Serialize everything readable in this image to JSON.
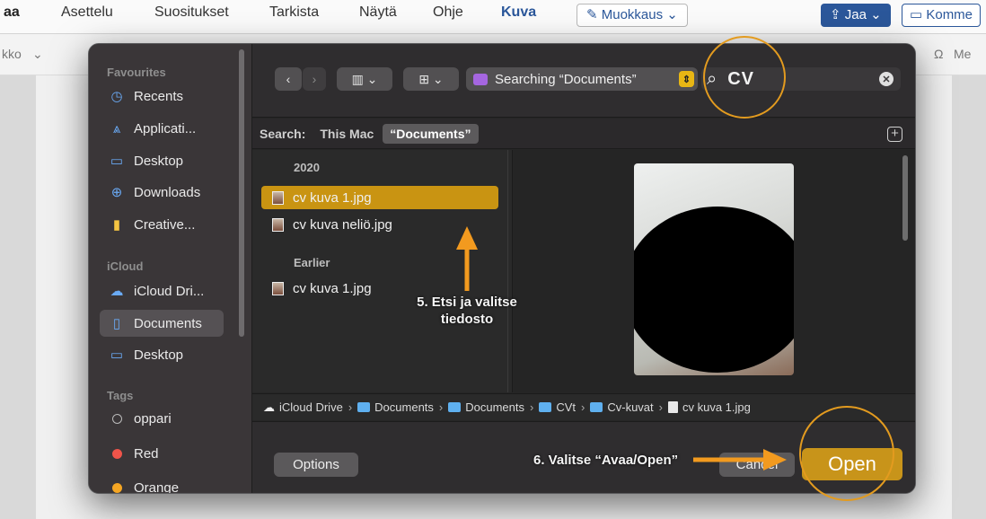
{
  "word": {
    "tabs": [
      "aa",
      "Asettelu",
      "Suositukset",
      "Tarkista",
      "Näytä",
      "Ohje",
      "Kuva"
    ],
    "edit_label": "Muokkaus",
    "share_label": "Jaa",
    "comment_label": "Komme",
    "toolbar_left": "kko",
    "toolbar_right": "Me"
  },
  "sidebar": {
    "favourites_title": "Favourites",
    "favourites": [
      {
        "label": "Recents",
        "icon": "clock-icon"
      },
      {
        "label": "Applicati...",
        "icon": "applications-icon"
      },
      {
        "label": "Desktop",
        "icon": "desktop-icon"
      },
      {
        "label": "Downloads",
        "icon": "download-icon"
      },
      {
        "label": "Creative...",
        "icon": "file-icon"
      }
    ],
    "icloud_title": "iCloud",
    "icloud": [
      {
        "label": "iCloud Dri...",
        "icon": "cloud-icon"
      },
      {
        "label": "Documents",
        "icon": "document-icon"
      },
      {
        "label": "Desktop",
        "icon": "desktop-icon"
      }
    ],
    "tags_title": "Tags",
    "tags": [
      {
        "label": "oppari",
        "color": "#3a3638"
      },
      {
        "label": "Red",
        "color": "#f0544a"
      },
      {
        "label": "Orange",
        "color": "#f5a623"
      }
    ]
  },
  "toolbar": {
    "location": "Searching “Documents”",
    "search_query": "CV"
  },
  "scope": {
    "label": "Search:",
    "this_mac": "This Mac",
    "documents": "“Documents”"
  },
  "files": {
    "group_2020": "2020",
    "group_earlier": "Earlier",
    "items_2020": [
      "cv kuva 1.jpg",
      "cv kuva neliö.jpg"
    ],
    "items_earlier": [
      "cv kuva 1.jpg"
    ]
  },
  "path": [
    "iCloud Drive",
    "Documents",
    "Documents",
    "CVt",
    "Cv-kuvat",
    "cv kuva 1.jpg"
  ],
  "footer": {
    "options": "Options",
    "cancel": "Cancel",
    "open": "Open"
  },
  "annotations": {
    "step5_line1": "5. Etsi ja valitse",
    "step5_line2": "tiedosto",
    "step6": "6. Valitse “Avaa/Open”"
  },
  "colors": {
    "accent_annotation": "#e39b1f",
    "selection": "#c99412"
  }
}
